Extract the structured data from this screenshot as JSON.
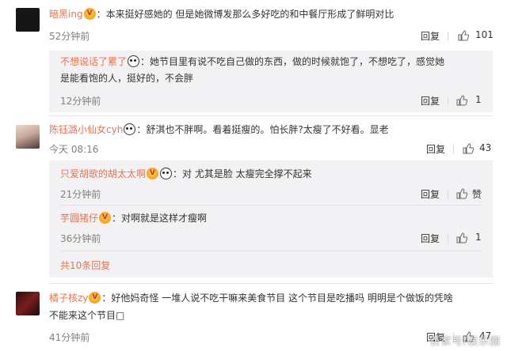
{
  "comments": [
    {
      "username": "暗黑ing",
      "text": "：本来挺好感她的 但是她微博发那么多好吃的和中餐厅形成了鲜明对比",
      "time": "52分钟前",
      "reply": "回复",
      "likes": "101"
    },
    {
      "username": "陈钰潞小仙女cyh",
      "text": "：舒淇也不胖啊。看着挺瘦的。怕长胖?太瘦了不好看。显老",
      "time": "今天 08:16",
      "reply": "回复",
      "likes": "43"
    },
    {
      "username": "橘子核zy",
      "text_line1": "：好他妈奇怪 一堆人说不吃干嘛来美食节目 这个节目是吃播吗 明明是个做饭的凭啥",
      "text_line2": "不能来这个节目□",
      "time": "41分钟前",
      "reply": "回复",
      "likes": "47"
    }
  ],
  "replies": [
    {
      "username": "不想说话了累了",
      "text_line1": "：她节目里有说不吃自己做的东西，做的时候就饱了，不想吃了，感觉她",
      "text_line2": "是能看饱的人，挺好的，不会胖",
      "time": "12分钟前",
      "reply": "回复",
      "likes": "1"
    },
    {
      "username": "只爱胡歌的胡太太啊",
      "text": "：对 尤其是脸 太瘦完全撑不起来",
      "time": "21分钟前",
      "reply": "回复",
      "likes": "赞"
    },
    {
      "username": "芋圆猪仔",
      "text": "：对啊就是这样才瘦啊",
      "time": "36分钟前",
      "reply": "回复",
      "likes": "1"
    }
  ],
  "more_replies": "共10条回复",
  "watermark": "百家号/娱乐圈",
  "colors": {
    "username": "#eb7350",
    "reply_bg": "#f2f2f5"
  }
}
